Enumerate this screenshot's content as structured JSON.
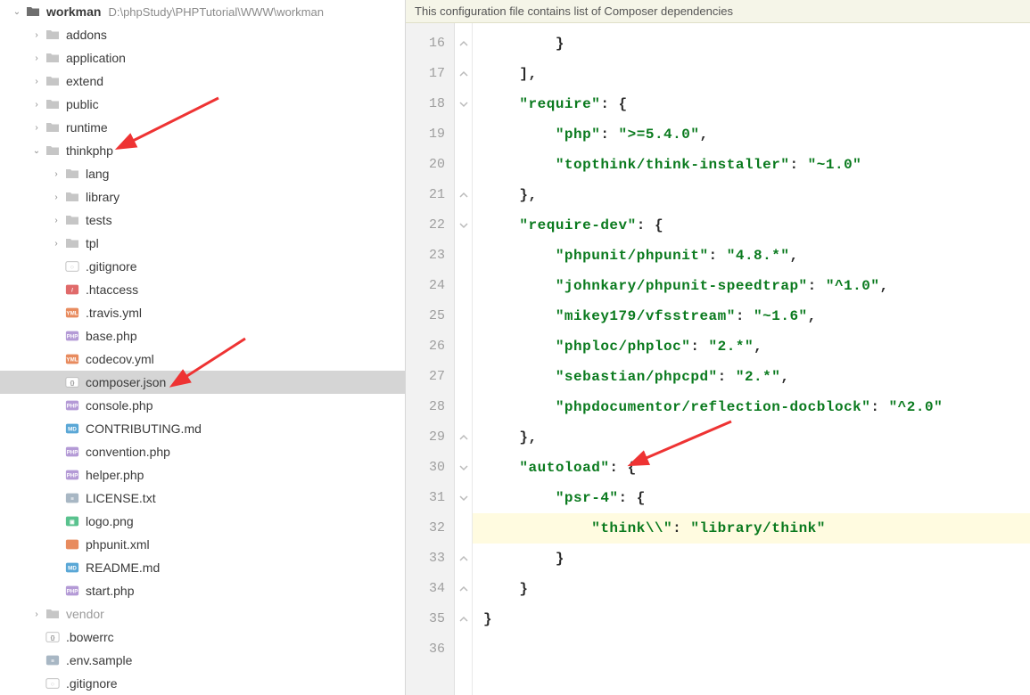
{
  "project": {
    "name": "workman",
    "path": "D:\\phpStudy\\PHPTutorial\\WWW\\workman"
  },
  "tree": [
    {
      "depth": 0,
      "arrow": "expanded",
      "icon": "folder-root",
      "label": "workman",
      "bold": true,
      "pathAfter": true
    },
    {
      "depth": 1,
      "arrow": "collapsed",
      "icon": "folder",
      "label": "addons"
    },
    {
      "depth": 1,
      "arrow": "collapsed",
      "icon": "folder",
      "label": "application"
    },
    {
      "depth": 1,
      "arrow": "collapsed",
      "icon": "folder",
      "label": "extend"
    },
    {
      "depth": 1,
      "arrow": "collapsed",
      "icon": "folder",
      "label": "public"
    },
    {
      "depth": 1,
      "arrow": "collapsed",
      "icon": "folder",
      "label": "runtime"
    },
    {
      "depth": 1,
      "arrow": "expanded",
      "icon": "folder",
      "label": "thinkphp"
    },
    {
      "depth": 2,
      "arrow": "collapsed",
      "icon": "folder",
      "label": "lang"
    },
    {
      "depth": 2,
      "arrow": "collapsed",
      "icon": "folder",
      "label": "library"
    },
    {
      "depth": 2,
      "arrow": "collapsed",
      "icon": "folder",
      "label": "tests"
    },
    {
      "depth": 2,
      "arrow": "collapsed",
      "icon": "folder",
      "label": "tpl"
    },
    {
      "depth": 2,
      "arrow": "none",
      "icon": "file-git",
      "label": ".gitignore"
    },
    {
      "depth": 2,
      "arrow": "none",
      "icon": "file-ht",
      "label": ".htaccess"
    },
    {
      "depth": 2,
      "arrow": "none",
      "icon": "file-yml",
      "label": ".travis.yml"
    },
    {
      "depth": 2,
      "arrow": "none",
      "icon": "file-php",
      "label": "base.php"
    },
    {
      "depth": 2,
      "arrow": "none",
      "icon": "file-yml",
      "label": "codecov.yml"
    },
    {
      "depth": 2,
      "arrow": "none",
      "icon": "file-json",
      "label": "composer.json",
      "selected": true
    },
    {
      "depth": 2,
      "arrow": "none",
      "icon": "file-php",
      "label": "console.php"
    },
    {
      "depth": 2,
      "arrow": "none",
      "icon": "file-md",
      "label": "CONTRIBUTING.md"
    },
    {
      "depth": 2,
      "arrow": "none",
      "icon": "file-php",
      "label": "convention.php"
    },
    {
      "depth": 2,
      "arrow": "none",
      "icon": "file-php",
      "label": "helper.php"
    },
    {
      "depth": 2,
      "arrow": "none",
      "icon": "file-txt",
      "label": "LICENSE.txt"
    },
    {
      "depth": 2,
      "arrow": "none",
      "icon": "file-img",
      "label": "logo.png"
    },
    {
      "depth": 2,
      "arrow": "none",
      "icon": "file-xml",
      "label": "phpunit.xml"
    },
    {
      "depth": 2,
      "arrow": "none",
      "icon": "file-md",
      "label": "README.md"
    },
    {
      "depth": 2,
      "arrow": "none",
      "icon": "file-php",
      "label": "start.php"
    },
    {
      "depth": 1,
      "arrow": "collapsed",
      "icon": "folder-dim",
      "label": "vendor",
      "dim": true
    },
    {
      "depth": 1,
      "arrow": "none",
      "icon": "file-json",
      "label": ".bowerrc"
    },
    {
      "depth": 1,
      "arrow": "none",
      "icon": "file-txt",
      "label": ".env.sample"
    },
    {
      "depth": 1,
      "arrow": "none",
      "icon": "file-git",
      "label": ".gitignore"
    }
  ],
  "editor": {
    "bannerText": "This configuration file contains list of Composer dependencies",
    "startLine": 16,
    "highlightedLine": 32,
    "lines": [
      {
        "indent": 2,
        "tokens": [
          {
            "t": "}",
            "c": "p"
          }
        ]
      },
      {
        "indent": 1,
        "tokens": [
          {
            "t": "],",
            "c": "p"
          }
        ]
      },
      {
        "indent": 1,
        "tokens": [
          {
            "t": "\"require\"",
            "c": "k"
          },
          {
            "t": ": {",
            "c": "p"
          }
        ]
      },
      {
        "indent": 2,
        "tokens": [
          {
            "t": "\"php\"",
            "c": "k"
          },
          {
            "t": ": ",
            "c": "p"
          },
          {
            "t": "\">=5.4.0\"",
            "c": "v"
          },
          {
            "t": ",",
            "c": "p"
          }
        ]
      },
      {
        "indent": 2,
        "tokens": [
          {
            "t": "\"topthink/think-installer\"",
            "c": "k"
          },
          {
            "t": ": ",
            "c": "p"
          },
          {
            "t": "\"~1.0\"",
            "c": "v"
          }
        ]
      },
      {
        "indent": 1,
        "tokens": [
          {
            "t": "},",
            "c": "p"
          }
        ]
      },
      {
        "indent": 1,
        "tokens": [
          {
            "t": "\"require-dev\"",
            "c": "k"
          },
          {
            "t": ": {",
            "c": "p"
          }
        ]
      },
      {
        "indent": 2,
        "tokens": [
          {
            "t": "\"phpunit/phpunit\"",
            "c": "k"
          },
          {
            "t": ": ",
            "c": "p"
          },
          {
            "t": "\"4.8.*\"",
            "c": "v"
          },
          {
            "t": ",",
            "c": "p"
          }
        ]
      },
      {
        "indent": 2,
        "tokens": [
          {
            "t": "\"johnkary/phpunit-speedtrap\"",
            "c": "k"
          },
          {
            "t": ": ",
            "c": "p"
          },
          {
            "t": "\"^1.0\"",
            "c": "v"
          },
          {
            "t": ",",
            "c": "p"
          }
        ]
      },
      {
        "indent": 2,
        "tokens": [
          {
            "t": "\"mikey179/vfsstream\"",
            "c": "k"
          },
          {
            "t": ": ",
            "c": "p"
          },
          {
            "t": "\"~1.6\"",
            "c": "v"
          },
          {
            "t": ",",
            "c": "p"
          }
        ]
      },
      {
        "indent": 2,
        "tokens": [
          {
            "t": "\"phploc/phploc\"",
            "c": "k"
          },
          {
            "t": ": ",
            "c": "p"
          },
          {
            "t": "\"2.*\"",
            "c": "v"
          },
          {
            "t": ",",
            "c": "p"
          }
        ]
      },
      {
        "indent": 2,
        "tokens": [
          {
            "t": "\"sebastian/phpcpd\"",
            "c": "k"
          },
          {
            "t": ": ",
            "c": "p"
          },
          {
            "t": "\"2.*\"",
            "c": "v"
          },
          {
            "t": ",",
            "c": "p"
          }
        ]
      },
      {
        "indent": 2,
        "tokens": [
          {
            "t": "\"phpdocumentor/reflection-docblock\"",
            "c": "k"
          },
          {
            "t": ": ",
            "c": "p"
          },
          {
            "t": "\"^2.0\"",
            "c": "v"
          }
        ]
      },
      {
        "indent": 1,
        "tokens": [
          {
            "t": "},",
            "c": "p"
          }
        ]
      },
      {
        "indent": 1,
        "tokens": [
          {
            "t": "\"autoload\"",
            "c": "k"
          },
          {
            "t": ": {",
            "c": "p"
          }
        ]
      },
      {
        "indent": 2,
        "tokens": [
          {
            "t": "\"psr-4\"",
            "c": "k"
          },
          {
            "t": ": {",
            "c": "p"
          }
        ]
      },
      {
        "indent": 3,
        "tokens": [
          {
            "t": "\"think\\\\\"",
            "c": "k"
          },
          {
            "t": ": ",
            "c": "p"
          },
          {
            "t": "\"library/think\"",
            "c": "v"
          }
        ]
      },
      {
        "indent": 2,
        "tokens": [
          {
            "t": "}",
            "c": "p"
          }
        ]
      },
      {
        "indent": 1,
        "tokens": [
          {
            "t": "}",
            "c": "p"
          }
        ]
      },
      {
        "indent": 0,
        "tokens": [
          {
            "t": "}",
            "c": "p"
          }
        ]
      },
      {
        "indent": 0,
        "tokens": []
      }
    ],
    "foldMarkers": {
      "16": "close",
      "17": "close",
      "18": "open",
      "21": "close",
      "22": "open",
      "29": "close",
      "30": "open",
      "31": "open",
      "33": "close",
      "34": "close",
      "35": "close"
    }
  },
  "iconBadges": {
    "file-php": {
      "text": "PHP",
      "bg": "#b49ad6"
    },
    "file-yml": {
      "text": "YML",
      "bg": "#e88b5e"
    },
    "file-md": {
      "text": "MD",
      "bg": "#5aa7d6"
    },
    "file-xml": {
      "text": "</>",
      "bg": "#e88b5e"
    },
    "file-json": {
      "text": "{}",
      "bg": "#ffffff"
    },
    "file-txt": {
      "text": "≡",
      "bg": "#a8b7c4"
    },
    "file-git": {
      "text": "◌",
      "bg": "#ffffff"
    },
    "file-ht": {
      "text": "/",
      "bg": "#e06a6a"
    },
    "file-img": {
      "text": "▣",
      "bg": "#59c28e"
    }
  }
}
